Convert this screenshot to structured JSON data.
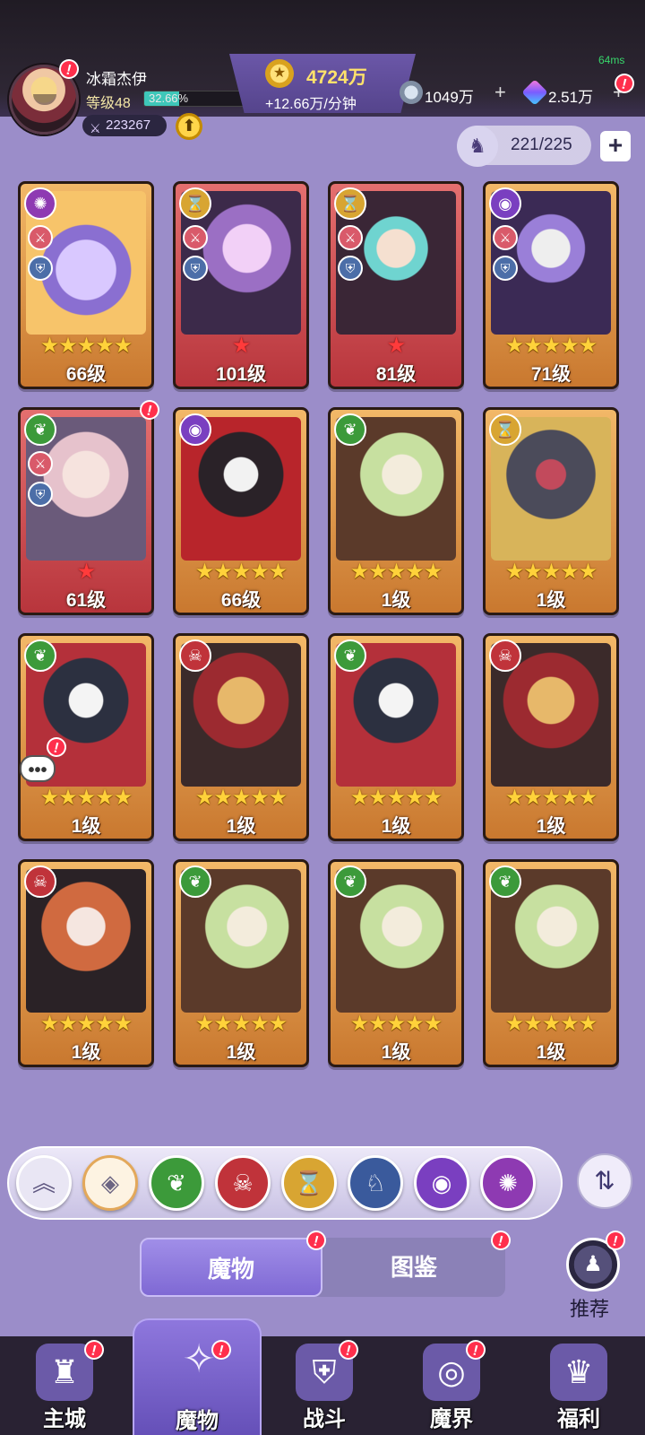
{
  "player": {
    "name": "冰霜杰伊",
    "level_label": "等级48",
    "xp_percent_text": "32.66%",
    "xp_fraction": 0.3266,
    "power": "223267"
  },
  "currency": {
    "gold": "4724万",
    "gold_rate": "+12.66万/分钟",
    "silver": "1049万",
    "gems": "2.51万"
  },
  "ping": "64ms",
  "roster": {
    "count": "221/225"
  },
  "badge_mark": "!",
  "cards": [
    {
      "level": "66级",
      "stars": "★★★★★",
      "frame": "gold",
      "faction": "vortex"
    },
    {
      "level": "101级",
      "stars": "★",
      "frame": "red",
      "faction": "hourglass"
    },
    {
      "level": "81级",
      "stars": "★",
      "frame": "red",
      "faction": "hourglass"
    },
    {
      "level": "71级",
      "stars": "★★★★★",
      "frame": "gold",
      "faction": "eye"
    },
    {
      "level": "61级",
      "stars": "★",
      "frame": "red",
      "faction": "leaf"
    },
    {
      "level": "66级",
      "stars": "★★★★★",
      "frame": "gold",
      "faction": "eye"
    },
    {
      "level": "1级",
      "stars": "★★★★★",
      "frame": "gold",
      "faction": "leaf"
    },
    {
      "level": "1级",
      "stars": "★★★★★",
      "frame": "gold",
      "faction": "hourglass"
    },
    {
      "level": "1级",
      "stars": "★★★★★",
      "frame": "gold",
      "faction": "leaf"
    },
    {
      "level": "1级",
      "stars": "★★★★★",
      "frame": "gold",
      "faction": "demon"
    },
    {
      "level": "1级",
      "stars": "★★★★★",
      "frame": "gold",
      "faction": "leaf"
    },
    {
      "level": "1级",
      "stars": "★★★★★",
      "frame": "gold",
      "faction": "demon"
    },
    {
      "level": "1级",
      "stars": "★★★★★",
      "frame": "gold",
      "faction": "demon"
    },
    {
      "level": "1级",
      "stars": "★★★★★",
      "frame": "gold",
      "faction": "leaf"
    },
    {
      "level": "1级",
      "stars": "★★★★★",
      "frame": "gold",
      "faction": "leaf"
    },
    {
      "level": "1级",
      "stars": "★★★★★",
      "frame": "gold",
      "faction": "leaf"
    }
  ],
  "tabs": {
    "monsters": "魔物",
    "codex": "图鉴"
  },
  "recommend": "推荐",
  "nav": {
    "city": "主城",
    "monsters": "魔物",
    "battle": "战斗",
    "realm": "魔界",
    "welfare": "福利"
  },
  "colors": {
    "background": "#9b8dc9",
    "gold_text": "#ffe26b",
    "xp_fill": "#3ec7b9",
    "alert_red": "#ff2f4c",
    "star": "#ffd23a"
  }
}
